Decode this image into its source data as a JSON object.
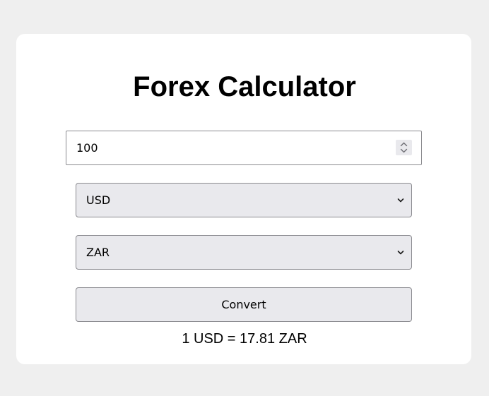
{
  "calculator": {
    "title": "Forex Calculator",
    "amount": {
      "value": "100",
      "spinner_icon": "number-spinner-icon"
    },
    "from_currency": {
      "selected": "USD",
      "dropdown_icon": "chevron-down-icon"
    },
    "to_currency": {
      "selected": "ZAR",
      "dropdown_icon": "chevron-down-icon"
    },
    "convert_label": "Convert",
    "result_text": "1 USD = 17.81 ZAR"
  },
  "colors": {
    "page_background": "#efefef",
    "card_background": "#ffffff",
    "control_background": "#e9e9ed",
    "control_border": "#8a8a8f",
    "text": "#000000"
  }
}
